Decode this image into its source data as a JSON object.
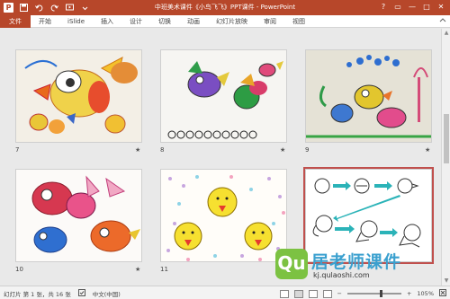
{
  "titlebar": {
    "app_logo": "P",
    "title": "中班美术课件《小鸟飞飞》PPT课件 - PowerPoint",
    "qat_icons": [
      "save-icon",
      "undo-icon",
      "redo-icon",
      "slideshow-icon",
      "customize-icon"
    ],
    "help": "?",
    "restore": "▭",
    "minimize": "—",
    "maximize": "□",
    "close": "✕"
  },
  "tabs": [
    "文件",
    "开始",
    "iSlide",
    "插入",
    "设计",
    "切换",
    "动画",
    "幻灯片放映",
    "审阅",
    "视图"
  ],
  "slides": [
    {
      "number": "7",
      "star": "★"
    },
    {
      "number": "8",
      "star": "★"
    },
    {
      "number": "9",
      "star": "★"
    },
    {
      "number": "10",
      "star": "★"
    },
    {
      "number": "11",
      "star": "★"
    },
    {
      "number": "",
      "star": ""
    }
  ],
  "watermark": {
    "mark": "Qu",
    "name": "居老师课件",
    "url": "kj.qulaoshi.com"
  },
  "status": {
    "slide_info": "幻灯片 第 1 张，共 16 张",
    "language": "中文(中国)",
    "zoom": "105%",
    "zoom_minus": "−",
    "zoom_plus": "+"
  },
  "colors": {
    "accent": "#b7472a"
  }
}
